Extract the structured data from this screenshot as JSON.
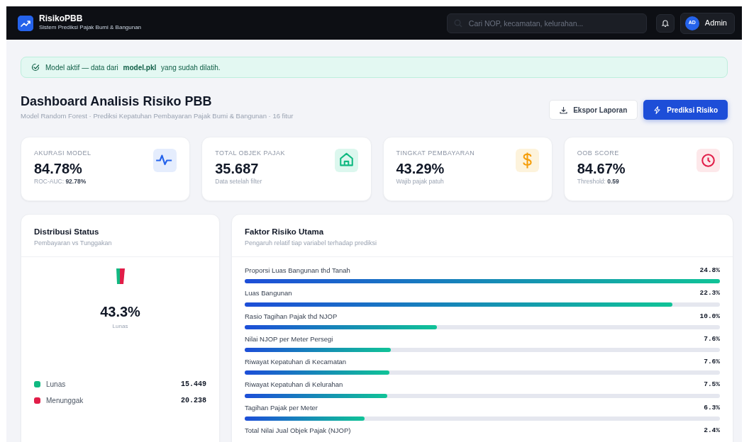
{
  "brand": {
    "name": "RisikoPBB",
    "tagline": "Sistem Prediksi Pajak Bumi & Bangunan"
  },
  "search": {
    "placeholder": "Cari NOP, kecamatan, kelurahan..."
  },
  "user": {
    "initials": "AD",
    "name": "Admin"
  },
  "alert": {
    "text": "Model aktif — data dari **model.pkl** yang sudah dilatih."
  },
  "page": {
    "title": "Dashboard Analisis Risiko PBB",
    "subtitle": "Model Random Forest · Prediksi Kepatuhan Pembayaran Pajak Bumi & Bangunan · 16 fitur"
  },
  "actions": [
    {
      "label": "Ekspor Laporan",
      "kind": "outline"
    },
    {
      "label": "Prediksi Risiko",
      "kind": "primary"
    }
  ],
  "stats": [
    {
      "label": "AKURASI MODEL",
      "value": "84.78%",
      "note": "ROC-AUC: **92.78%**",
      "kind": "pulse"
    },
    {
      "label": "TOTAL OBJEK PAJAK",
      "value": "35.687",
      "note": "Data setelah filter",
      "kind": "home"
    },
    {
      "label": "TINGKAT PEMBAYARAN",
      "value": "43.29%",
      "note": "Wajib pajak patuh",
      "kind": "dollar"
    },
    {
      "label": "OOB SCORE",
      "value": "84.67%",
      "note": "Threshold: **0.59**",
      "kind": "clock"
    }
  ],
  "distribution": {
    "title": "Distribusi Status",
    "subtitle": "Pembayaran vs Tunggakan",
    "center_value": "43.3%",
    "center_label": "Lunas",
    "legend": [
      {
        "label": "Lunas",
        "value": "15.449",
        "color": "#10b981"
      },
      {
        "label": "Menunggak",
        "value": "20.238",
        "color": "#e11d48"
      }
    ]
  },
  "factors": {
    "title": "Faktor Risiko Utama",
    "subtitle": "Pengaruh relatif tiap variabel terhadap prediksi",
    "items": [
      {
        "label": "Proporsi Luas Bangunan thd Tanah",
        "value": "24.8%",
        "level": 1.0
      },
      {
        "label": "Luas Bangunan",
        "value": "22.3%",
        "level": 0.9
      },
      {
        "label": "Rasio Tagihan Pajak thd NJOP",
        "value": "10.0%",
        "level": 0.404
      },
      {
        "label": "Nilai NJOP per Meter Persegi",
        "value": "7.6%",
        "level": 0.307
      },
      {
        "label": "Riwayat Kepatuhan di Kecamatan",
        "value": "7.6%",
        "level": 0.305
      },
      {
        "label": "Riwayat Kepatuhan di Kelurahan",
        "value": "7.5%",
        "level": 0.3
      },
      {
        "label": "Tagihan Pajak per Meter",
        "value": "6.3%",
        "level": 0.252
      },
      {
        "label": "Total Nilai Jual Objek Pajak (NJOP)",
        "value": "2.4%"
      }
    ]
  }
}
